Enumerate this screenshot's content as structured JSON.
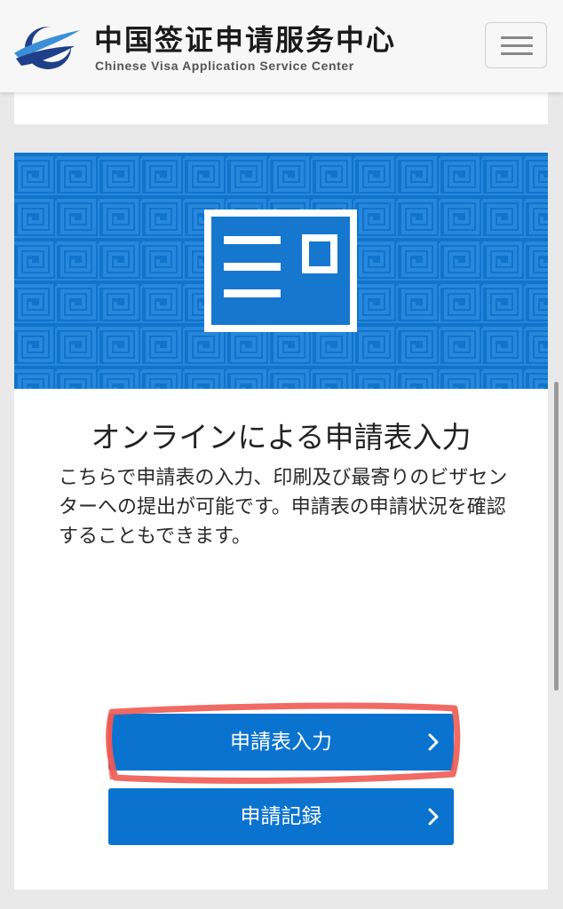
{
  "header": {
    "logo_cn": "中国签证申请服务中心",
    "logo_en": "Chinese Visa Application Service Center",
    "menu_icon": "hamburger-icon"
  },
  "card": {
    "banner_icon": "application-form-icon",
    "title": "オンラインによる申請表入力",
    "description": "こちらで申請表の入力、印刷及び最寄りのビザセンターへの提出が可能です。申請表の申請状況を確認することもできます。",
    "buttons": {
      "apply_label": "申請表入力",
      "records_label": "申請記録",
      "chevron_icon": "chevron-right-icon"
    }
  },
  "colors": {
    "banner_blue": "#0f74cc",
    "button_blue": "#0a73d0",
    "highlight_red": "#f05a52",
    "header_bg": "#f7f7f7",
    "page_bg": "#e9e9e9"
  }
}
